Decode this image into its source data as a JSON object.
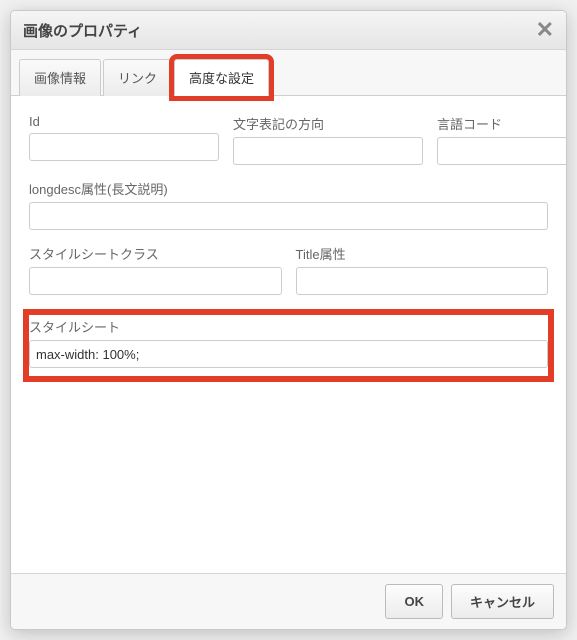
{
  "dialog": {
    "title": "画像のプロパティ",
    "tabs": {
      "info": "画像情報",
      "link": "リンク",
      "advanced": "高度な設定"
    },
    "fields": {
      "id_label": "Id",
      "id_value": "",
      "dir_label": "文字表記の方向",
      "dir_value": "",
      "lang_label": "言語コード",
      "lang_value": "",
      "longdesc_label": "longdesc属性(長文説明)",
      "longdesc_value": "",
      "styleclass_label": "スタイルシートクラス",
      "styleclass_value": "",
      "title_label": "Title属性",
      "title_value": "",
      "style_label": "スタイルシート",
      "style_value": "max-width: 100%;"
    },
    "buttons": {
      "ok": "OK",
      "cancel": "キャンセル"
    }
  }
}
